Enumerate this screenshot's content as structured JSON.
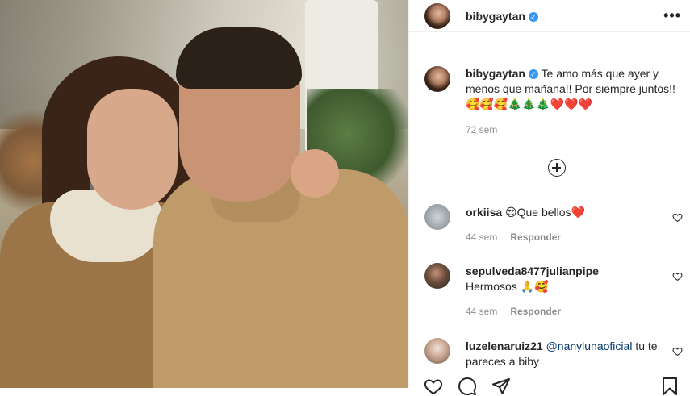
{
  "post": {
    "author": "bibygaytan",
    "caption_text": "Te amo más que ayer y menos que mañana!! Por siempre juntos!! 🥰🥰🥰🎄🎄🎄❤️❤️❤️",
    "time_ago": "72 sem"
  },
  "comments": [
    {
      "username": "orkiisa",
      "text": "😍Que bellos❤️",
      "time": "44 sem",
      "reply_label": "Responder"
    },
    {
      "username": "sepulveda8477julianpipe",
      "text": "Hermosos 🙏🥰",
      "time": "44 sem",
      "reply_label": "Responder"
    },
    {
      "username": "luzelenaruiz21",
      "mention": "@nanylunaoficial",
      "text": " tu te pareces a biby"
    }
  ],
  "icons": {
    "verified": "verified-badge-icon",
    "more": "more-options-icon",
    "load_more": "plus-circle-icon",
    "heart": "heart-outline-icon",
    "like": "heart-icon",
    "comment": "comment-icon",
    "share": "send-icon",
    "save": "bookmark-icon"
  },
  "colors": {
    "verified": "#3897f0",
    "muted": "#8e8e8e",
    "text": "#262626",
    "mention": "#00376b"
  }
}
